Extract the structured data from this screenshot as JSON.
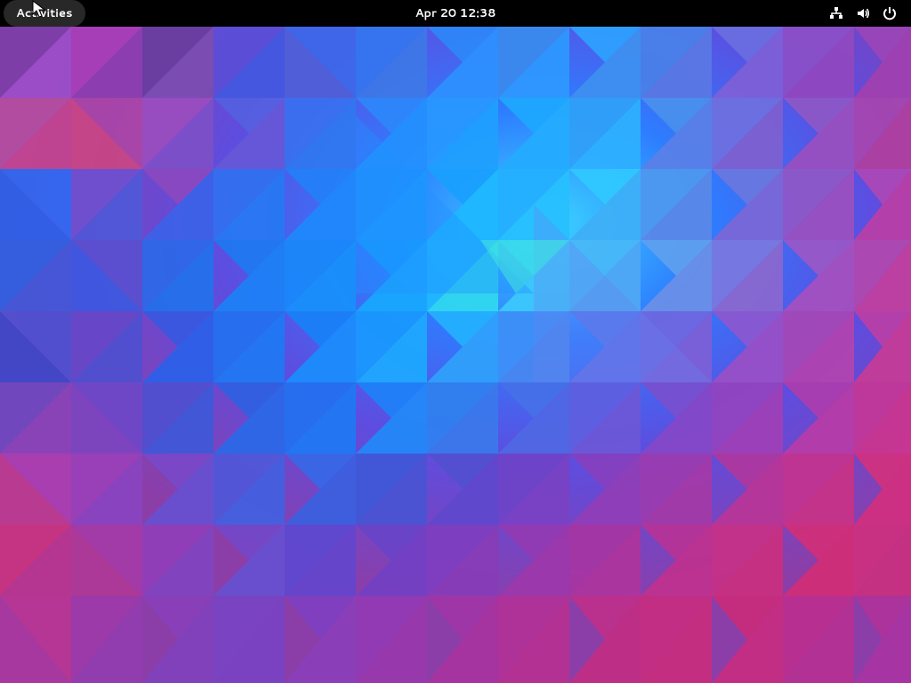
{
  "topbar": {
    "activities_label": "Activities",
    "clock": "Apr 20  12:38"
  },
  "icons": {
    "network": "network-icon",
    "volume": "volume-icon",
    "power": "power-icon"
  }
}
